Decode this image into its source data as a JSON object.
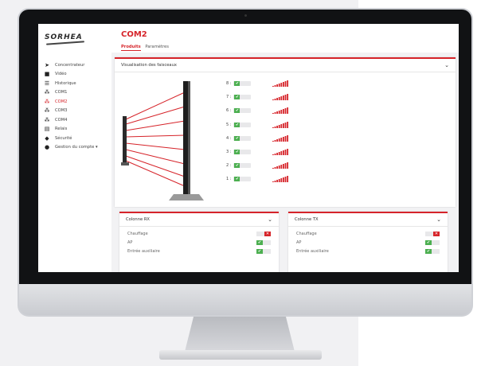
{
  "brand": {
    "logo_text": "SORHEA"
  },
  "sidebar": {
    "items": [
      {
        "label": "Concentrateur",
        "icon": "send-icon",
        "glyph": "➤"
      },
      {
        "label": "Vidéo",
        "icon": "video-icon",
        "glyph": "■"
      },
      {
        "label": "Historique",
        "icon": "list-icon",
        "glyph": "☰"
      },
      {
        "label": "COM1",
        "icon": "network-icon",
        "glyph": "⁂"
      },
      {
        "label": "COM2",
        "icon": "network-icon",
        "glyph": "⁂",
        "active": true
      },
      {
        "label": "COM3",
        "icon": "network-icon",
        "glyph": "⁂"
      },
      {
        "label": "COM4",
        "icon": "network-icon",
        "glyph": "⁂"
      },
      {
        "label": "Relais",
        "icon": "server-icon",
        "glyph": "▤"
      },
      {
        "label": "Sécurité",
        "icon": "shield-icon",
        "glyph": "◆"
      },
      {
        "label": "Gestion du compte ▾",
        "icon": "user-icon",
        "glyph": "●"
      }
    ]
  },
  "header": {
    "title": "COM2",
    "tabs": [
      {
        "label": "Produits",
        "active": true
      },
      {
        "label": "Paramètres"
      }
    ]
  },
  "beams_panel": {
    "title": "Visualisation des faisceaux",
    "beams": [
      {
        "label": "8 :",
        "state": "✔"
      },
      {
        "label": "7 :",
        "state": "✔"
      },
      {
        "label": "6 :",
        "state": "✔"
      },
      {
        "label": "5 :",
        "state": "✔"
      },
      {
        "label": "4 :",
        "state": "✔"
      },
      {
        "label": "3 :",
        "state": "✔"
      },
      {
        "label": "2 :",
        "state": "✔"
      },
      {
        "label": "1 :",
        "state": "✔"
      }
    ]
  },
  "column_rx": {
    "title": "Colonne RX",
    "rows": [
      {
        "label": "Chauffage",
        "on": false
      },
      {
        "label": "AP",
        "on": true
      },
      {
        "label": "Entrée auxiliaire",
        "on": true
      }
    ]
  },
  "column_tx": {
    "title": "Colonne TX",
    "rows": [
      {
        "label": "Chauffage",
        "on": false
      },
      {
        "label": "AP",
        "on": true
      },
      {
        "label": "Entrée auxiliaire",
        "on": true
      }
    ]
  },
  "colors": {
    "accent": "#d6242a",
    "ok": "#4caf50"
  }
}
